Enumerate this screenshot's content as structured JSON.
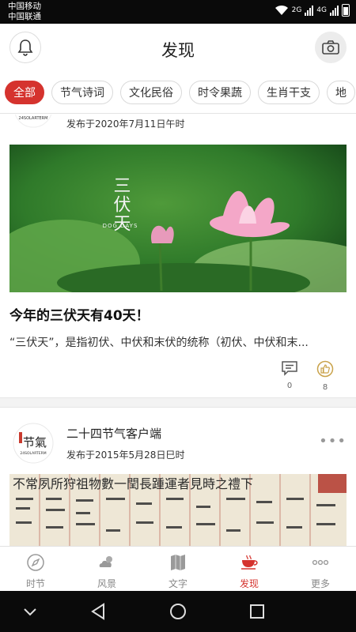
{
  "status": {
    "carrier1": "中国移动",
    "carrier2": "中国联通",
    "net1": "2G",
    "net2": "4G"
  },
  "header": {
    "title": "发现"
  },
  "tabs": [
    "全部",
    "节气诗词",
    "文化民俗",
    "时令果蔬",
    "生肖干支",
    "地"
  ],
  "posts": [
    {
      "date": "发布于2020年7月11日午时",
      "image_text_main": "三伏天",
      "image_text_sub": "DOG DAYS",
      "title": "今年的三伏天有40天！",
      "summary": "“三伏天”，是指初伏、中伏和末伏的统称（初伏、中伏和末...",
      "comments": "0",
      "likes": "8"
    },
    {
      "logo_text": "节氣",
      "logo_sub": "24SOLARTERM",
      "author": "二十四节气客户端",
      "date": "发布于2015年5月28日巳时",
      "image_text": "不常夙所狩祖物數一閏長踵運者見時之禮下"
    }
  ],
  "nav": [
    {
      "label": "时节",
      "icon": "compass-icon"
    },
    {
      "label": "风景",
      "icon": "weather-icon"
    },
    {
      "label": "文字",
      "icon": "book-icon"
    },
    {
      "label": "发现",
      "icon": "teacup-icon"
    },
    {
      "label": "更多",
      "icon": "more-icon"
    }
  ],
  "colors": {
    "accent": "#d5332e"
  }
}
